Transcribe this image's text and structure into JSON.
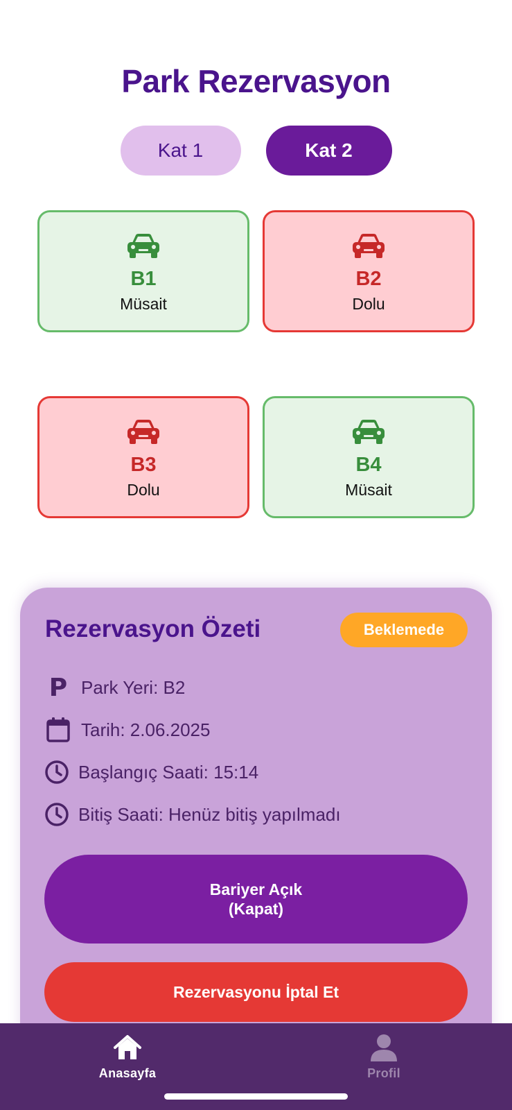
{
  "header": {
    "title": "Park Rezervasyon"
  },
  "floors": [
    {
      "label": "Kat 1",
      "active": false
    },
    {
      "label": "Kat 2",
      "active": true
    }
  ],
  "slots": [
    {
      "id": "B1",
      "status": "Müsait",
      "state": "free"
    },
    {
      "id": "B2",
      "status": "Dolu",
      "state": "busy"
    },
    {
      "id": "B3",
      "status": "Dolu",
      "state": "busy"
    },
    {
      "id": "B4",
      "status": "Müsait",
      "state": "free"
    }
  ],
  "colors": {
    "primary": "#4a148c",
    "accent": "#6a1b9a",
    "free_border": "#66bb6a",
    "free_bg": "#e6f4e6",
    "busy_border": "#e53935",
    "busy_bg": "#ffcdd2",
    "pending": "#ffa726",
    "nav_bg": "#522a6b"
  },
  "summary": {
    "title": "Rezervasyon Özeti",
    "badge": "Beklemede",
    "park_yeri": "Park Yeri: B2",
    "tarih": "Tarih: 2.06.2025",
    "baslangic": "Başlangıç Saati: 15:14",
    "bitis": "Bitiş Saati: Henüz bitiş yapılmadı",
    "barrier_line1": "Bariyer Açık",
    "barrier_line2": "(Kapat)",
    "cancel": "Rezervasyonu İptal Et",
    "park_icon_glyph": "P"
  },
  "nav": {
    "home": "Anasayfa",
    "profile": "Profil"
  },
  "icons": {
    "slot": "car-icon",
    "park": "parking-icon",
    "date": "calendar-icon",
    "time": "clock-icon",
    "home": "home-icon",
    "profile": "person-icon"
  }
}
